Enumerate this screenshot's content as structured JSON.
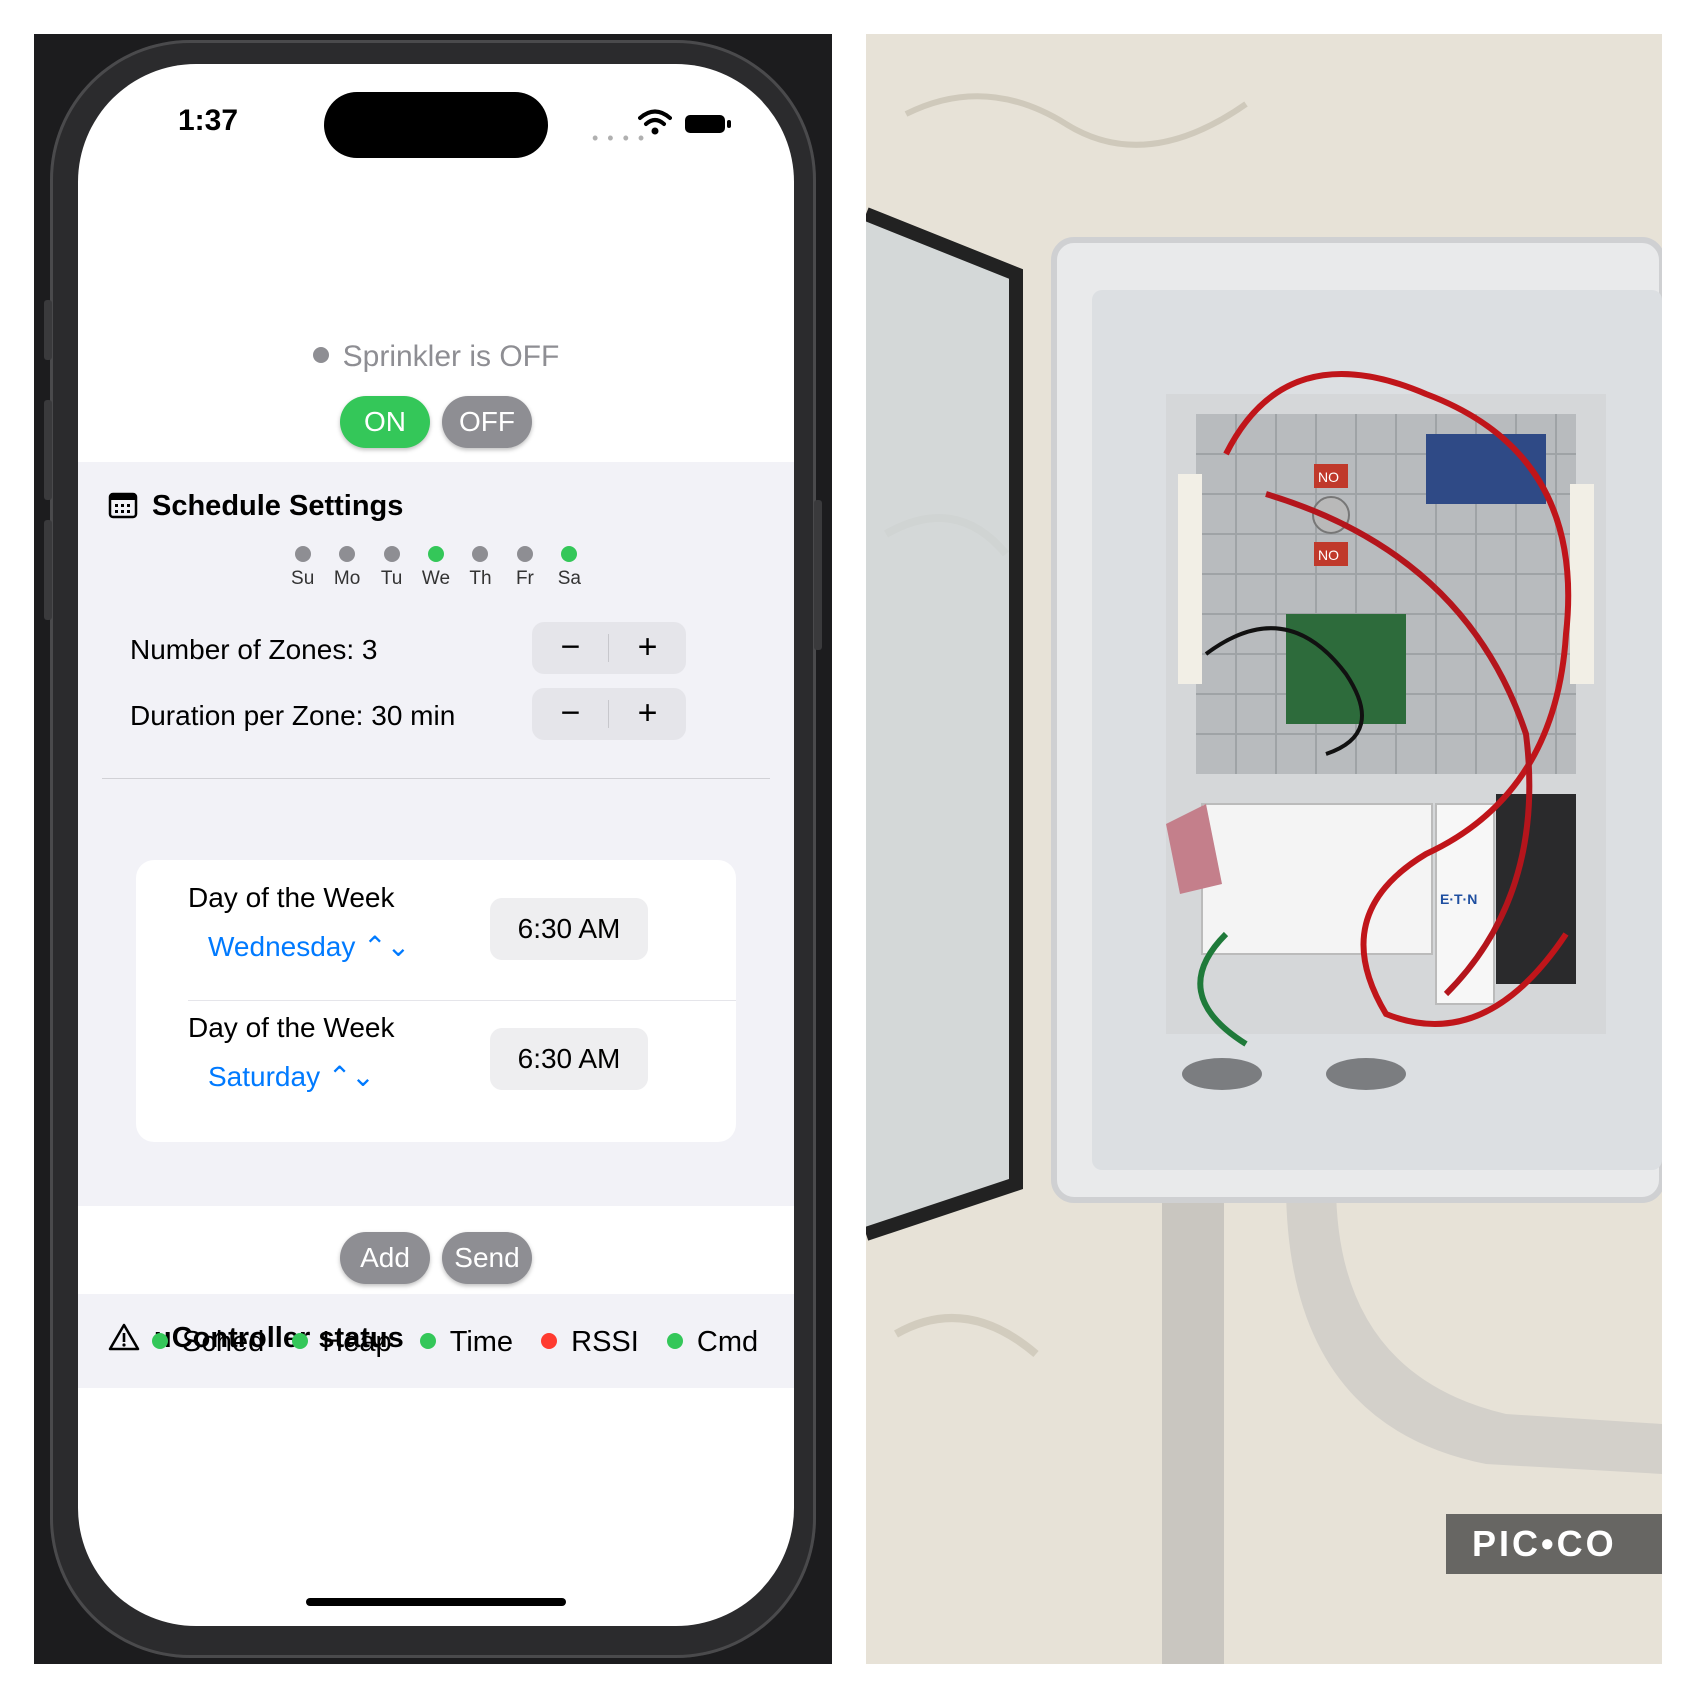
{
  "status_bar": {
    "time": "1:37"
  },
  "sprinkler": {
    "status_text": "Sprinkler is OFF",
    "on_label": "ON",
    "off_label": "OFF"
  },
  "schedule": {
    "title": "Schedule Settings",
    "days": [
      {
        "label": "Su",
        "active": false
      },
      {
        "label": "Mo",
        "active": false
      },
      {
        "label": "Tu",
        "active": false
      },
      {
        "label": "We",
        "active": true
      },
      {
        "label": "Th",
        "active": false
      },
      {
        "label": "Fr",
        "active": false
      },
      {
        "label": "Sa",
        "active": true
      }
    ],
    "zones_label": "Number of Zones: 3",
    "duration_label": "Duration per Zone: 30 min",
    "stepper_minus": "−",
    "stepper_plus": "+",
    "entries": [
      {
        "label": "Day of the Week",
        "day": "Wednesday ⌃⌄",
        "time": "6:30 AM"
      },
      {
        "label": "Day of the Week",
        "day": "Saturday ⌃⌄",
        "time": "6:30 AM"
      }
    ]
  },
  "actions": {
    "add_label": "Add",
    "send_label": "Send"
  },
  "controller": {
    "title": "uController status",
    "indicators": [
      {
        "label": "Sched",
        "status": "ok"
      },
      {
        "label": "Heap",
        "status": "ok"
      },
      {
        "label": "Time",
        "status": "ok"
      },
      {
        "label": "RSSI",
        "status": "error"
      },
      {
        "label": "Cmd",
        "status": "ok"
      }
    ]
  },
  "colors": {
    "green": "#34c759",
    "gray": "#8e8e93",
    "red": "#ff3b30",
    "blue": "#007aff"
  },
  "photo": {
    "watermark": "PIC•CO",
    "relay_toggle_labels": [
      "NO",
      "NO"
    ],
    "breaker_brand": "E·T·N"
  }
}
